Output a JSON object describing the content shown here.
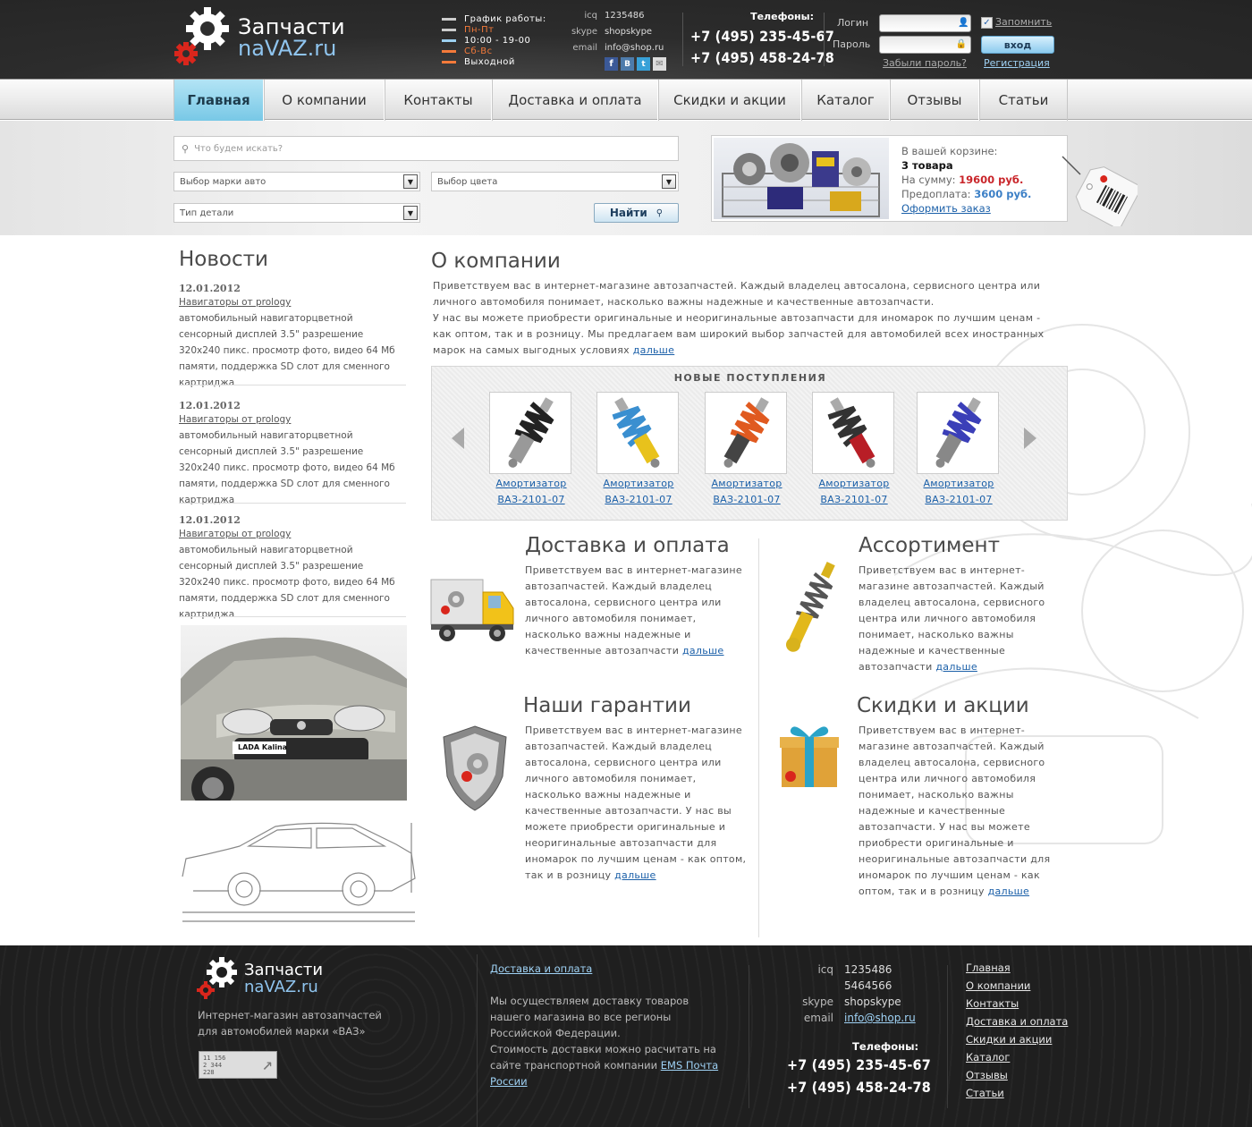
{
  "logo": {
    "line1": "Запчасти",
    "line2": "naVAZ.ru"
  },
  "schedule": {
    "title": "График работы:",
    "rows": [
      {
        "text": "Пн-Пт",
        "color": "#f47a3a"
      },
      {
        "text": "10:00 - 19-00",
        "color": "#ffffff"
      },
      {
        "text": "Сб-Вс",
        "color": "#f47a3a"
      },
      {
        "text": "Выходной",
        "color": "#ffffff"
      }
    ]
  },
  "contacts": {
    "icq_label": "icq",
    "icq": "1235486",
    "skype_label": "skype",
    "skype": "shopskype",
    "email_label": "email",
    "email": "info@shop.ru"
  },
  "phones": {
    "title": "Телефоны:",
    "phone1": "+7 (495) 235-45-67",
    "phone2": "+7 (495) 458-24-78"
  },
  "login": {
    "login_label": "Логин",
    "password_label": "Пароль",
    "remember": "Запомнить",
    "submit": "вход",
    "forgot": "Забыли пароль?",
    "register": "Регистрация"
  },
  "nav": [
    "Главная",
    "О компании",
    "Контакты",
    "Доставка и оплата",
    "Скидки и акции",
    "Каталог",
    "Отзывы",
    "Статьи"
  ],
  "search": {
    "placeholder": "Что будем искать?",
    "brand": "Выбор марки авто",
    "color": "Выбор цвета",
    "part_type": "Тип детали",
    "button": "Найти"
  },
  "cart": {
    "label": "В вашей корзине:",
    "count": "3 товара",
    "sum_label": "На сумму:",
    "sum": "19600 руб.",
    "prepay_label": "Предоплата:",
    "prepay": "3600 руб.",
    "checkout": "Оформить заказ"
  },
  "news": {
    "title": "Новости",
    "items": [
      {
        "date": "12.01.2012",
        "link": "Навигаторы от prology",
        "text": "автомобильный навигаторцветной сенсорный дисплей 3.5\" разрешение 320x240 пикс. просмотр фото, видео 64 Мб памяти, поддержка SD слот для сменного картриджа"
      },
      {
        "date": "12.01.2012",
        "link": "Навигаторы от prology",
        "text": "автомобильный навигаторцветной сенсорный дисплей 3.5\" разрешение 320x240 пикс. просмотр фото, видео 64 Мб памяти, поддержка SD слот для сменного картриджа"
      },
      {
        "date": "12.01.2012",
        "link": "Навигаторы от prology",
        "text": "автомобильный навигаторцветной сенсорный дисплей 3.5\" разрешение 320x240 пикс. просмотр фото, видео 64 Мб памяти, поддержка SD слот для сменного картриджа"
      }
    ]
  },
  "about": {
    "title": "О компании",
    "p1": "Приветствуем вас в интернет-магазине автозапчастей. Каждый владелец автосалона, сервисного центра или личного автомобиля понимает, насколько важны надежные и качественные автозапчасти.",
    "p2": "У нас вы можете приобрести оригинальные и неоригинальные автозапчасти для иномарок по лучшим ценам - как оптом, так и в розницу. Мы предлагаем вам широкий выбор запчастей для автомобилей всех иностранных марок на самых выгодных условиях",
    "more": "дальше"
  },
  "new_arrivals": {
    "title": "НОВЫЕ ПОСТУПЛЕНИЯ",
    "items": [
      {
        "l1": "Амортизатор",
        "l2": "ВАЗ-2101-07",
        "spring": "#222222",
        "body": "#999999"
      },
      {
        "l1": "Амортизатор",
        "l2": "ВАЗ-2101-07",
        "spring": "#3a8fd0",
        "body": "#e8c21c"
      },
      {
        "l1": "Амортизатор",
        "l2": "ВАЗ-2101-07",
        "spring": "#e05a20",
        "body": "#444444"
      },
      {
        "l1": "Амортизатор",
        "l2": "ВАЗ-2101-07",
        "spring": "#333333",
        "body": "#b81e26"
      },
      {
        "l1": "Амортизатор",
        "l2": "ВАЗ-2101-07",
        "spring": "#3b3fb8",
        "body": "#888888"
      }
    ]
  },
  "blocks": [
    {
      "title": "Доставка и оплата",
      "text": "Приветствуем вас в интернет-магазине автозапчастей. Каждый владелец автосалона, сервисного центра или личного автомобиля понимает, насколько важны надежные и качественные автозапчасти",
      "more": "дальше"
    },
    {
      "title": "Ассортимент",
      "text": "Приветствуем вас в интернет-магазине автозапчастей. Каждый владелец автосалона, сервисного центра или личного автомобиля понимает, насколько важны надежные и качественные автозапчасти",
      "more": "дальше"
    },
    {
      "title": "Наши гарантии",
      "text": "Приветствуем вас в интернет-магазине автозапчастей. Каждый владелец автосалона, сервисного центра или личного автомобиля понимает, насколько важны надежные и качественные автозапчасти. У нас вы можете приобрести оригинальные и неоригинальные автозапчасти для иномарок по лучшим ценам - как оптом, так и в розницу",
      "more": "дальше"
    },
    {
      "title": "Скидки и акции",
      "text": "Приветствуем вас в интернет-магазине автозапчастей. Каждый владелец автосалона, сервисного центра или личного автомобиля понимает, насколько важны надежные и качественные автозапчасти. У нас вы можете приобрести оригинальные и неоригинальные автозапчасти для иномарок по лучшим ценам - как оптом, так и в розницу",
      "more": "дальше"
    }
  ],
  "promo_car": {
    "plate": "LADA Kalina"
  },
  "footer": {
    "desc": "Интернет-магазин автозапчастей для автомобилей марки «ВАЗ»",
    "counter": [
      "11 156",
      "2 344",
      "228"
    ],
    "delivery_link": "Доставка и оплата",
    "delivery_text": "Мы осуществляем доставку товаров нашего магазина во все регионы Российской Федерации.",
    "delivery_text2": "Стоимость доставки можно расчитать на сайте транспортной компании",
    "ems": "EMS Почта России",
    "icq_label": "icq",
    "icq1": "1235486",
    "icq2": "5464566",
    "skype_label": "skype",
    "skype": "shopskype",
    "email_label": "email",
    "email": "info@shop.ru",
    "phones_title": "Телефоны:",
    "phone1": "+7 (495) 235-45-67",
    "phone2": "+7 (495) 458-24-78",
    "links": [
      "Главная",
      "О компании",
      "Контакты",
      "Доставка и оплата",
      "Скидки и акции",
      "Каталог",
      "Отзывы",
      "Статьи"
    ]
  }
}
